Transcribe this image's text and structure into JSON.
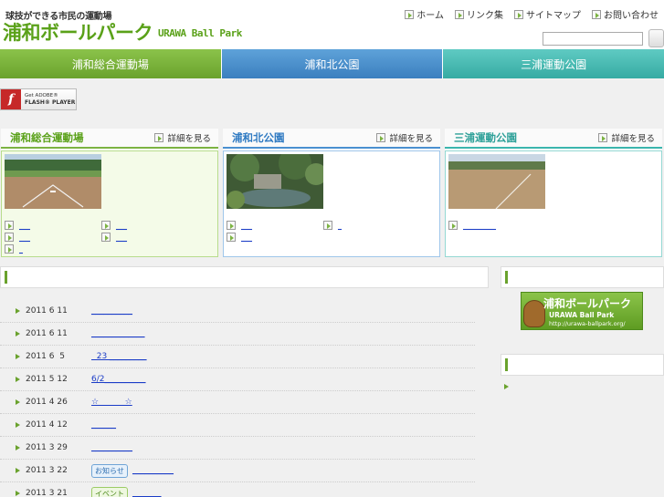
{
  "header": {
    "tagline": "球技ができる市民の運動場",
    "logo": "浦和ボールパーク",
    "logo_en": "URAWA Ball Park",
    "util_nav": [
      "ホーム",
      "リンク集",
      "サイトマップ",
      "お問い合わせ"
    ]
  },
  "tabs": [
    "浦和総合運動場",
    "浦和北公園",
    "三浦運動公園"
  ],
  "flash": {
    "line1": "Get ADOBE®",
    "line2": "FLASH® PLAYER"
  },
  "parks": [
    {
      "title": "浦和総合運動場",
      "detail": "詳細を見る",
      "links": [
        "___",
        "___",
        "___",
        "___",
        "_"
      ]
    },
    {
      "title": "浦和北公園",
      "detail": "詳細を見る",
      "links": [
        "___",
        "_",
        "___"
      ]
    },
    {
      "title": "三浦運動公園",
      "detail": "詳細を見る",
      "links": [
        "_________"
      ]
    }
  ],
  "news": [
    {
      "date": "2011 6 11",
      "title": "__________",
      "tag": ""
    },
    {
      "date": "2011 6 11",
      "title": "_____________",
      "tag": ""
    },
    {
      "date": "2011 6  5",
      "title": "  23 _________",
      "tag": ""
    },
    {
      "date": "2011 5 12",
      "title": "6/2__________",
      "tag": ""
    },
    {
      "date": "2011 4 26",
      "title": "☆          ☆",
      "tag": ""
    },
    {
      "date": "2011 4 12",
      "title": "______",
      "tag": ""
    },
    {
      "date": "2011 3 29",
      "title": "__________",
      "tag": ""
    },
    {
      "date": "2011 3 22",
      "title": "__________",
      "tag": "お知らせ"
    },
    {
      "date": "2011 3 21",
      "title": "_______",
      "tag": "イベント"
    }
  ],
  "sidebar": {
    "banner_title": "浦和ボールパーク",
    "banner_en": "URAWA Ball Park",
    "banner_url": "http://urawa-ballpark.org/"
  }
}
